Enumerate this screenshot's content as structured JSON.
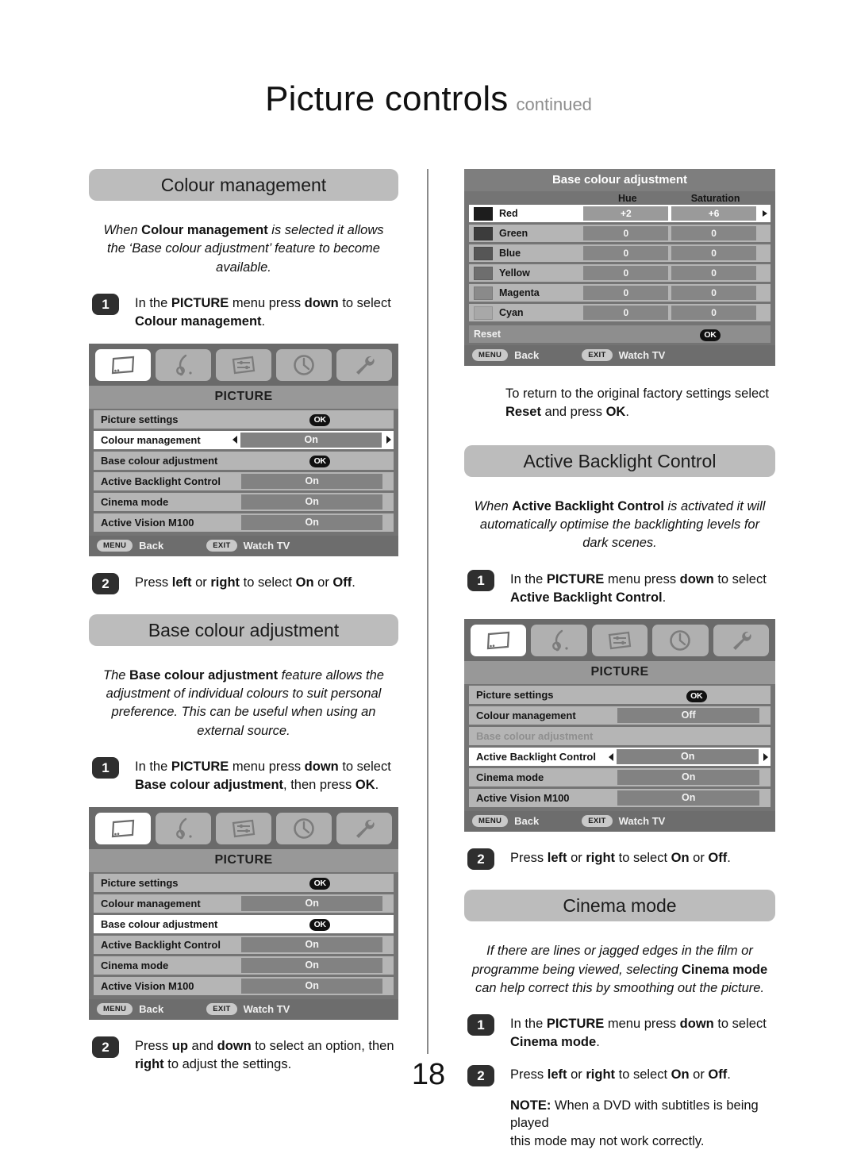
{
  "header": {
    "title": "Picture controls",
    "continued": "continued"
  },
  "page_number": "18",
  "osd_common": {
    "menu_title": "PICTURE",
    "icons": [
      "picture-icon",
      "sound-icon",
      "preferences-icon",
      "clock-icon",
      "setup-icon"
    ],
    "footer": {
      "menu_key": "MENU",
      "menu_action": "Back",
      "exit_key": "EXIT",
      "exit_action": "Watch TV"
    },
    "ok_badge": "OK"
  },
  "left_column": {
    "colour_management": {
      "pill": "Colour management",
      "intro_parts": [
        {
          "t": "When ",
          "s": "i"
        },
        {
          "t": "Colour management",
          "s": "b"
        },
        {
          "t": " is selected it allows the ‘Base colour adjustment’ feature to become available.",
          "s": "i"
        }
      ],
      "intro_text": "When Colour management is selected it allows the ‘Base colour adjustment’ feature to become available.",
      "steps": [
        {
          "num": "1",
          "text": "In the PICTURE menu press down to select Colour management."
        },
        {
          "num": "2",
          "text": "Press left or right to select On or Off."
        }
      ],
      "osd": {
        "title": "PICTURE",
        "rows": [
          {
            "label": "Picture settings",
            "type": "ok",
            "value": "OK",
            "selected": false,
            "disabled": false
          },
          {
            "label": "Colour management",
            "type": "value",
            "value": "On",
            "selected": true,
            "disabled": false
          },
          {
            "label": "Base colour adjustment",
            "type": "ok",
            "value": "OK",
            "selected": false,
            "disabled": false
          },
          {
            "label": "Active Backlight Control",
            "type": "value",
            "value": "On",
            "selected": false,
            "disabled": false
          },
          {
            "label": "Cinema mode",
            "type": "value",
            "value": "On",
            "selected": false,
            "disabled": false
          },
          {
            "label": "Active Vision M100",
            "type": "value",
            "value": "On",
            "selected": false,
            "disabled": false
          }
        ]
      }
    },
    "base_colour_adjustment": {
      "pill": "Base colour adjustment",
      "intro_text": "The Base colour adjustment feature allows the adjustment of individual colours to suit personal preference. This can be useful when using an external source.",
      "steps": [
        {
          "num": "1",
          "text": "In the PICTURE menu press down to select Base colour adjustment, then press OK."
        },
        {
          "num": "2",
          "text": "Press up and down to select an option, then right to adjust the settings."
        }
      ],
      "osd": {
        "title": "PICTURE",
        "rows": [
          {
            "label": "Picture settings",
            "type": "ok",
            "value": "OK",
            "selected": false,
            "disabled": false
          },
          {
            "label": "Colour management",
            "type": "value",
            "value": "On",
            "selected": false,
            "disabled": false
          },
          {
            "label": "Base colour adjustment",
            "type": "ok",
            "value": "OK",
            "selected": true,
            "disabled": false
          },
          {
            "label": "Active Backlight Control",
            "type": "value",
            "value": "On",
            "selected": false,
            "disabled": false
          },
          {
            "label": "Cinema mode",
            "type": "value",
            "value": "On",
            "selected": false,
            "disabled": false
          },
          {
            "label": "Active Vision M100",
            "type": "value",
            "value": "On",
            "selected": false,
            "disabled": false
          }
        ]
      }
    }
  },
  "right_column": {
    "base_colour_table": {
      "title": "Base colour adjustment",
      "columns": [
        "",
        "Hue",
        "Saturation"
      ],
      "rows": [
        {
          "name": "Red",
          "swatch": "#1d1d1d",
          "hue": "+2",
          "saturation": "+6",
          "selected": true
        },
        {
          "name": "Green",
          "swatch": "#3c3c3c",
          "hue": "0",
          "saturation": "0",
          "selected": false
        },
        {
          "name": "Blue",
          "swatch": "#565656",
          "hue": "0",
          "saturation": "0",
          "selected": false
        },
        {
          "name": "Yellow",
          "swatch": "#6e6e6e",
          "hue": "0",
          "saturation": "0",
          "selected": false
        },
        {
          "name": "Magenta",
          "swatch": "#8a8a8a",
          "hue": "0",
          "saturation": "0",
          "selected": false
        },
        {
          "name": "Cyan",
          "swatch": "#a8a8a8",
          "hue": "0",
          "saturation": "0",
          "selected": false
        }
      ],
      "reset_label": "Reset",
      "reset_ok": "OK"
    },
    "reset_note": "To return to the original factory settings select Reset and press OK.",
    "active_backlight": {
      "pill": "Active Backlight Control",
      "intro_text": "When Active Backlight Control is activated it will automatically optimise the backlighting levels for dark scenes.",
      "steps": [
        {
          "num": "1",
          "text": "In the PICTURE menu press down to select Active Backlight Control."
        },
        {
          "num": "2",
          "text": "Press left or right to select On or Off."
        }
      ],
      "osd": {
        "title": "PICTURE",
        "rows": [
          {
            "label": "Picture settings",
            "type": "ok",
            "value": "OK",
            "selected": false,
            "disabled": false
          },
          {
            "label": "Colour management",
            "type": "value",
            "value": "Off",
            "selected": false,
            "disabled": false
          },
          {
            "label": "Base colour adjustment",
            "type": "none",
            "value": "",
            "selected": false,
            "disabled": true
          },
          {
            "label": "Active Backlight Control",
            "type": "value",
            "value": "On",
            "selected": true,
            "disabled": false
          },
          {
            "label": "Cinema mode",
            "type": "value",
            "value": "On",
            "selected": false,
            "disabled": false
          },
          {
            "label": "Active Vision M100",
            "type": "value",
            "value": "On",
            "selected": false,
            "disabled": false
          }
        ]
      }
    },
    "cinema_mode": {
      "pill": "Cinema mode",
      "intro_text": "If there are lines or jagged edges in the film or programme being viewed, selecting Cinema mode can help correct this by smoothing out the picture.",
      "steps": [
        {
          "num": "1",
          "text": "In the PICTURE menu press down to select Cinema mode."
        },
        {
          "num": "2",
          "text": "Press left or right to select On or Off."
        }
      ],
      "note": "NOTE: When a DVD with subtitles is being played this mode may not work correctly."
    }
  }
}
